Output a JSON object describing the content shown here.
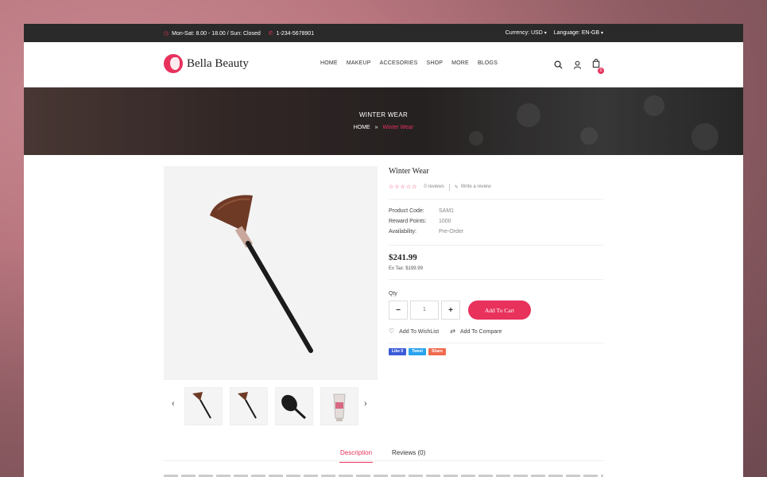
{
  "topbar": {
    "hours": "Mon-Sat: 8.00 - 18.00 / Sun: Closed",
    "phone": "1-234-5678901",
    "currency": "Currency: USD",
    "language": "Language: EN-GB"
  },
  "header": {
    "logo_text": "Bella Beauty",
    "nav": [
      "HOME",
      "MAKEUP",
      "ACCESORIES",
      "SHOP",
      "MORE",
      "BLOGS"
    ],
    "cart_count": "0"
  },
  "banner": {
    "title": "WINTER WEAR",
    "crumb_home": "HOME",
    "crumb_sep": "»",
    "crumb_current": "Winter Wear"
  },
  "product": {
    "title": "Winter Wear",
    "stars": "☆☆☆☆☆",
    "reviews": "0 reviews",
    "write_review": "Write a review",
    "specs": [
      {
        "k": "Product Code:",
        "v": "SAM1"
      },
      {
        "k": "Reward Points:",
        "v": "1000"
      },
      {
        "k": "Availability:",
        "v": "Pre-Order"
      }
    ],
    "price": "$241.99",
    "ex_tax": "Ex Tax: $199.99",
    "qty_label": "Qty",
    "qty_value": "1",
    "add_to_cart": "Add To Cart",
    "wishlist": "Add To WishList",
    "compare": "Add To Compare",
    "social": [
      "Like 0",
      "Tweet",
      "Share"
    ]
  },
  "tabs": [
    "Description",
    "Reviews (0)"
  ],
  "colors": {
    "accent": "#e8315b",
    "topbar": "#2a2a2a"
  }
}
